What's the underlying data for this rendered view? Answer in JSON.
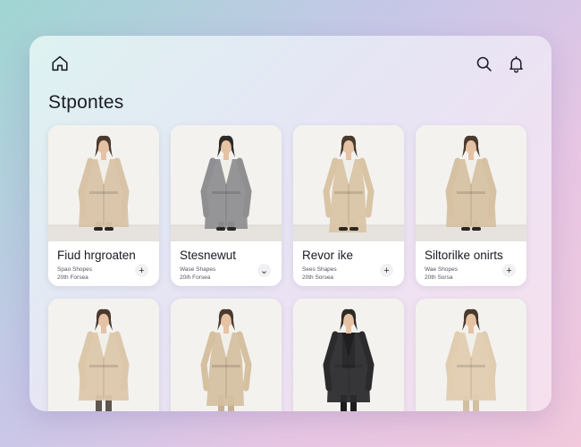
{
  "header": {
    "home_icon": "home-icon",
    "search_icon": "search-icon",
    "bell_icon": "bell-icon"
  },
  "section": {
    "title": "Stpontes"
  },
  "products": [
    {
      "name": "Fiud hrgroaten",
      "line1": "Spao Shopes",
      "line2": "20th Forsea",
      "action_icon": "plus-icon",
      "action_glyph": "+",
      "coat": "#d8c3a6",
      "inner": "#6e645a",
      "pose": 0
    },
    {
      "name": "Stesnewut",
      "line1": "Wase Shapes",
      "line2": "20ih Forsea",
      "action_icon": "chevron-down-icon",
      "action_glyph": "⌄",
      "coat": "#8f8f92",
      "inner": "#2a2a2c",
      "pose": 1
    },
    {
      "name": "Revor ike",
      "line1": "Sees Shapes",
      "line2": "20th Sorsea",
      "action_icon": "plus-icon",
      "action_glyph": "+",
      "coat": "#d9c4a4",
      "inner": "#cdb99a",
      "pose": 2
    },
    {
      "name": "Siltorilke onirts",
      "line1": "Wae Shopes",
      "line2": "20th Sorsa",
      "action_icon": "plus-icon",
      "action_glyph": "+",
      "coat": "#d6c1a2",
      "inner": "#c8b394",
      "pose": 3
    },
    {
      "coat": "#dcc7aa",
      "inner": "#5d5750",
      "pose": 0
    },
    {
      "coat": "#d5c0a0",
      "inner": "#c5b091",
      "pose": 2
    },
    {
      "coat": "#2b2b2d",
      "inner": "#1d1d1f",
      "pose": 1
    },
    {
      "coat": "#e0ccb0",
      "inner": "#d2bfa2",
      "pose": 3
    }
  ]
}
